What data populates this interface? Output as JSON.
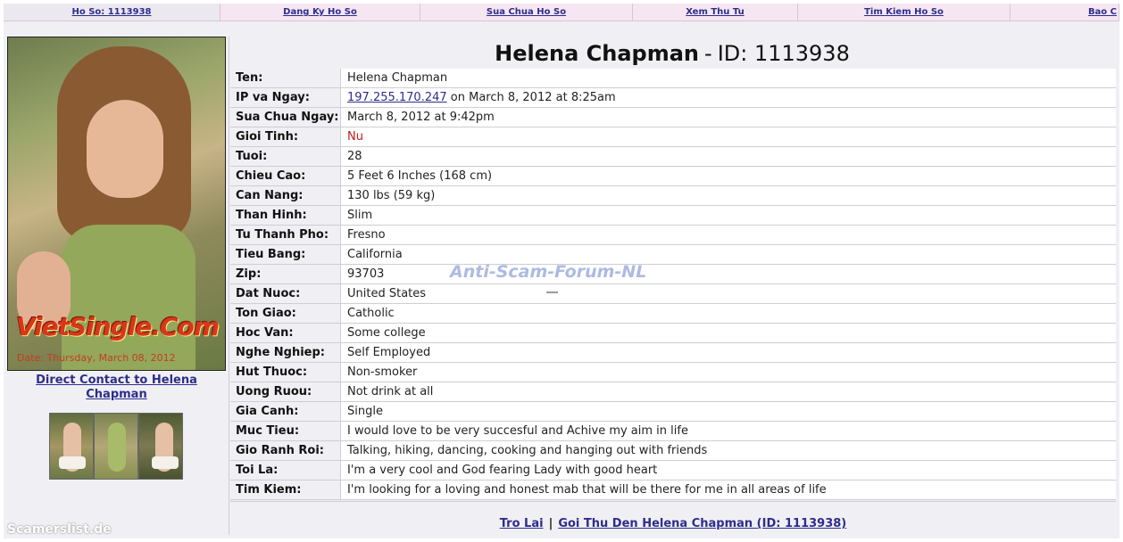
{
  "nav": [
    {
      "label": "Ho So: 1113938"
    },
    {
      "label": "Dang Ky Ho So"
    },
    {
      "label": "Sua Chua Ho So"
    },
    {
      "label": "Xem Thu Tu"
    },
    {
      "label": "Tim Kiem Ho So"
    },
    {
      "label": "Bao C"
    }
  ],
  "profile": {
    "name": "Helena Chapman",
    "separator": "-",
    "id_label": "ID: 1113938",
    "photo_brand": "VietSingle.Com",
    "photo_date": "Date: Thursday, March 08, 2012",
    "direct_contact": "Direct Contact to Helena Chapman",
    "thumb_count": 3
  },
  "fields": [
    {
      "label": "Ten:",
      "value": "Helena Chapman"
    },
    {
      "label": "IP va Ngay:",
      "link": "197.255.170.247",
      "value": " on March 8, 2012 at 8:25am"
    },
    {
      "label": "Sua Chua Ngay:",
      "value": "March 8, 2012 at 9:42pm"
    },
    {
      "label": "Gioi Tinh:",
      "value": "Nu",
      "color": "#c21a1a"
    },
    {
      "label": "Tuoi:",
      "value": "28"
    },
    {
      "label": "Chieu Cao:",
      "value": "5 Feet 6 Inches (168 cm)"
    },
    {
      "label": "Can Nang:",
      "value": "130 lbs (59 kg)"
    },
    {
      "label": "Than Hinh:",
      "value": "Slim"
    },
    {
      "label": "Tu Thanh Pho:",
      "value": "Fresno"
    },
    {
      "label": "Tieu Bang:",
      "value": "California"
    },
    {
      "label": "Zip:",
      "value": "93703"
    },
    {
      "label": "Dat Nuoc:",
      "value": "United States"
    },
    {
      "label": "Ton Giao:",
      "value": "Catholic"
    },
    {
      "label": "Hoc Van:",
      "value": "Some college"
    },
    {
      "label": "Nghe Nghiep:",
      "value": "Self Employed"
    },
    {
      "label": "Hut Thuoc:",
      "value": "Non-smoker"
    },
    {
      "label": "Uong Ruou:",
      "value": "Not drink at all"
    },
    {
      "label": "Gia Canh:",
      "value": "Single"
    },
    {
      "label": "Muc Tieu:",
      "value": "I would love to be very succesful and Achive my aim in life"
    },
    {
      "label": "Gio Ranh Roi:",
      "value": "Talking, hiking, dancing, cooking and hanging out with friends"
    },
    {
      "label": "Toi La:",
      "value": "I'm a very cool and God fearing Lady with good heart"
    },
    {
      "label": "Tim Kiem:",
      "value": "I'm looking for a loving and honest mab that will be there for me in all areas of life"
    }
  ],
  "watermark": "Anti-Scam-Forum-NL",
  "footer": {
    "back": "Tro Lai",
    "divider": "|",
    "message": "Goi Thu Den Helena Chapman (ID: 1113938)"
  },
  "credit": "Scamerslist.de"
}
